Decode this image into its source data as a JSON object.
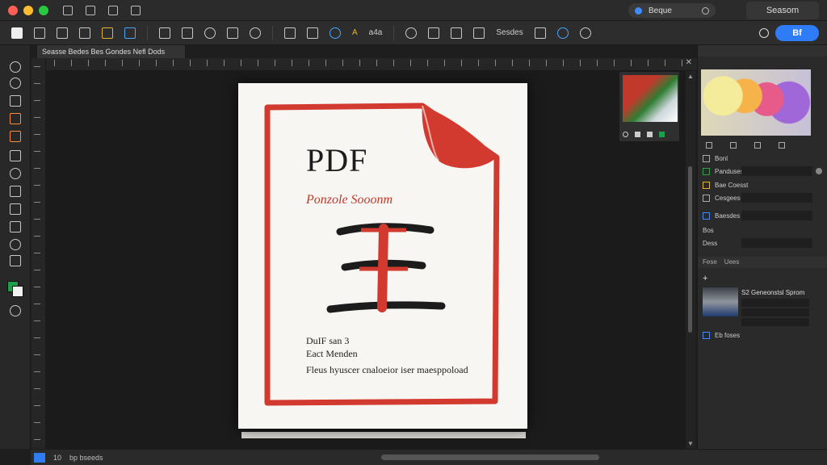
{
  "titlebar": {
    "traffic_lights": [
      "#ff5f57",
      "#febc2e",
      "#28c840"
    ],
    "search_label": "Beque",
    "right_button_label": "Seasom"
  },
  "optionsbar": {
    "font_label": "A",
    "size_label": "a4a",
    "style_label": "Sesdes",
    "share_button_label": "Bf"
  },
  "document": {
    "tab_label": "Seasse Bedes  Bes  Gondes  Nefl Dods"
  },
  "page": {
    "title": "PDF",
    "subtitle": "Ponzole Sooonm",
    "line1": "DuIF san 3",
    "line2": "Eact Menden",
    "line3": "Fleus hyuscer cnaloeior iser maesppoload",
    "accent_color": "#d23a2f"
  },
  "rightpanel": {
    "layers": [
      {
        "name": "Bonl"
      },
      {
        "name": "Panduses"
      },
      {
        "name": "Bae Coesst"
      },
      {
        "name": "Cesgees"
      },
      {
        "name": "Baesdes"
      },
      {
        "name": "Bos"
      },
      {
        "name": "Dess"
      }
    ],
    "section_tab": "Fese",
    "section_tab2": "Uees",
    "layer_title": "S2 Geneonstsl Sprom",
    "layer_footer": "Eb foses"
  },
  "statusbar": {
    "zoom_text": "10",
    "doc_info": "bp bseeds"
  }
}
